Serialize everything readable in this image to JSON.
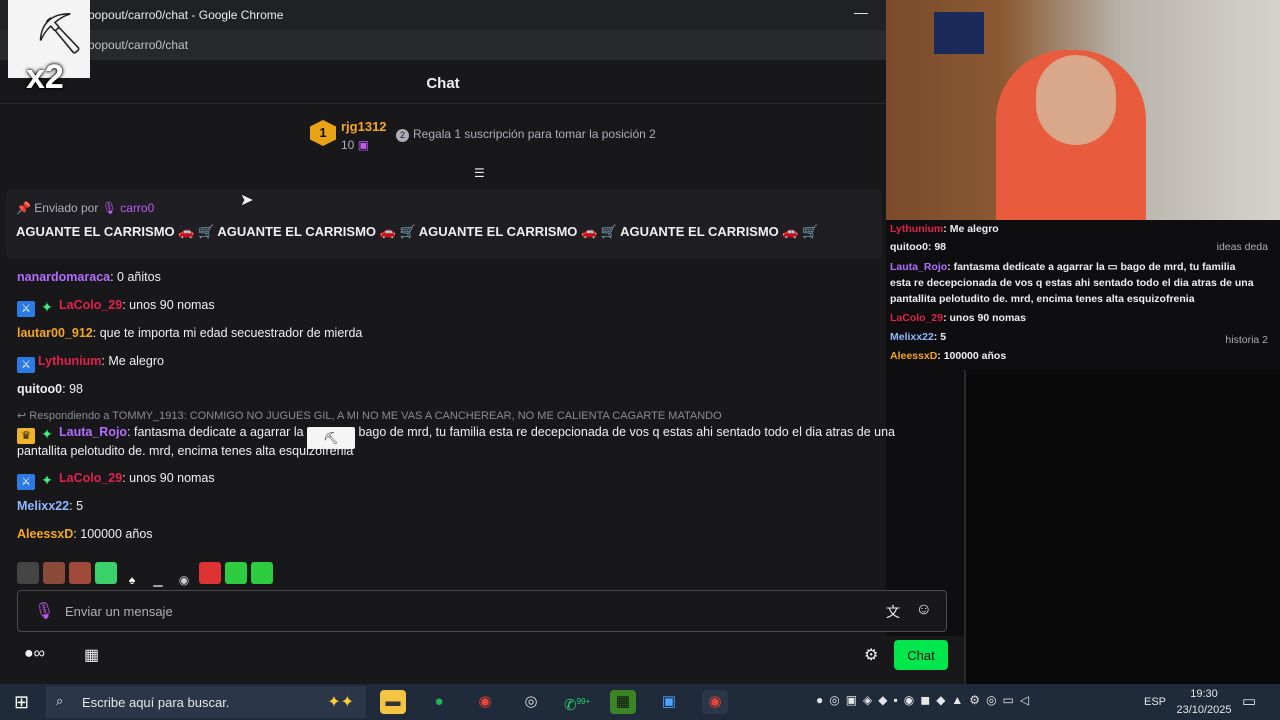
{
  "window": {
    "title": "popout/carro0/chat - Google Chrome",
    "address": "popout/carro0/chat",
    "overlay_label": "x2"
  },
  "chat": {
    "header": "Chat",
    "leaderboard": {
      "rank": "1",
      "name": "rjg1312",
      "count": "10",
      "gift_text": "Regala 1 suscripción para tomar la posición 2"
    },
    "pinned": {
      "label": "Enviado por",
      "author": "carro0",
      "message": "AGUANTE EL CARRISMO 🚗 🛒 AGUANTE EL CARRISMO 🚗 🛒 AGUANTE EL CARRISMO 🚗 🛒 AGUANTE EL CARRISMO 🚗 🛒"
    },
    "messages": [
      {
        "user": "nanardomaraca",
        "text": ": 0 añitos",
        "color": "#b46dff"
      },
      {
        "user": "LaColo_29",
        "text": ": unos 90 nomas",
        "color": "#e0234a"
      },
      {
        "user": "lautar00_912",
        "text": ": que te importa mi edad secuestrador de mierda",
        "color": "#f5a623"
      },
      {
        "user": "Lythunium",
        "text": ": Me alegro",
        "color": "#e0234a"
      },
      {
        "user": "quitoo0",
        "text": ": 98",
        "color": "#efeff1"
      },
      {
        "user": "Lauta_Rojo",
        "text1": ": fantasma dedicate a agarrar la",
        "text2": "bago de mrd, tu familia esta re decepcionada de vos q estas ahi sentado todo el dia atras de una",
        "text3": "pantallita pelotudito de. mrd, encima tenes alta esquizofrenia",
        "color": "#b46dff"
      },
      {
        "user": "LaColo_29",
        "text": ": unos 90 nomas",
        "color": "#e0234a"
      },
      {
        "user": "Melixx22",
        "text": ": 5",
        "color": "#8fb8ff"
      },
      {
        "user": "AleessxD",
        "text": ": 100000 años",
        "color": "#f5a623"
      }
    ],
    "reply_to": "Respondiendo a TOMMY_1913: CONMIGO NO JUGUES GIL, A MI NO ME VAS A CANCHEREAR, NO ME CALIENTA CAGARTE MATANDO",
    "input_placeholder": "Enviar un mensaje",
    "send_label": "Chat"
  },
  "overlay": {
    "lines": [
      {
        "user": "Lythunium",
        "text": ": Me alegro",
        "color": "#e0234a"
      },
      {
        "user": "quitoo0",
        "text": ": 98",
        "color": "#efeff1",
        "side": "ideas deda"
      },
      {
        "user": "Lauta_Rojo",
        "text": ": fantasma dedicate a agarrar la ▭ bago de mrd, tu familia",
        "color": "#b46dff"
      },
      {
        "user": "",
        "text": "esta re decepcionada de vos q estas ahi sentado todo el dia atras de una",
        "color": "#efeff1"
      },
      {
        "user": "",
        "text": "pantallita pelotudito de. mrd, encima tenes alta esquizofrenia",
        "color": "#efeff1"
      },
      {
        "user": "LaColo_29",
        "text": ": unos 90 nomas",
        "color": "#e0234a"
      },
      {
        "user": "Melixx22",
        "text": ": 5",
        "color": "#8fb8ff",
        "side": "historia 2"
      },
      {
        "user": "AleessxD",
        "text": ": 100000 años",
        "color": "#f5a623"
      }
    ]
  },
  "taskbar": {
    "search_placeholder": "Escribe aquí para buscar.",
    "badge": "99+",
    "lang": "ESP",
    "time": "19:30",
    "date": "23/10/2025"
  },
  "colors": {
    "accent": "#00e64d",
    "purple": "#bf5af2"
  }
}
